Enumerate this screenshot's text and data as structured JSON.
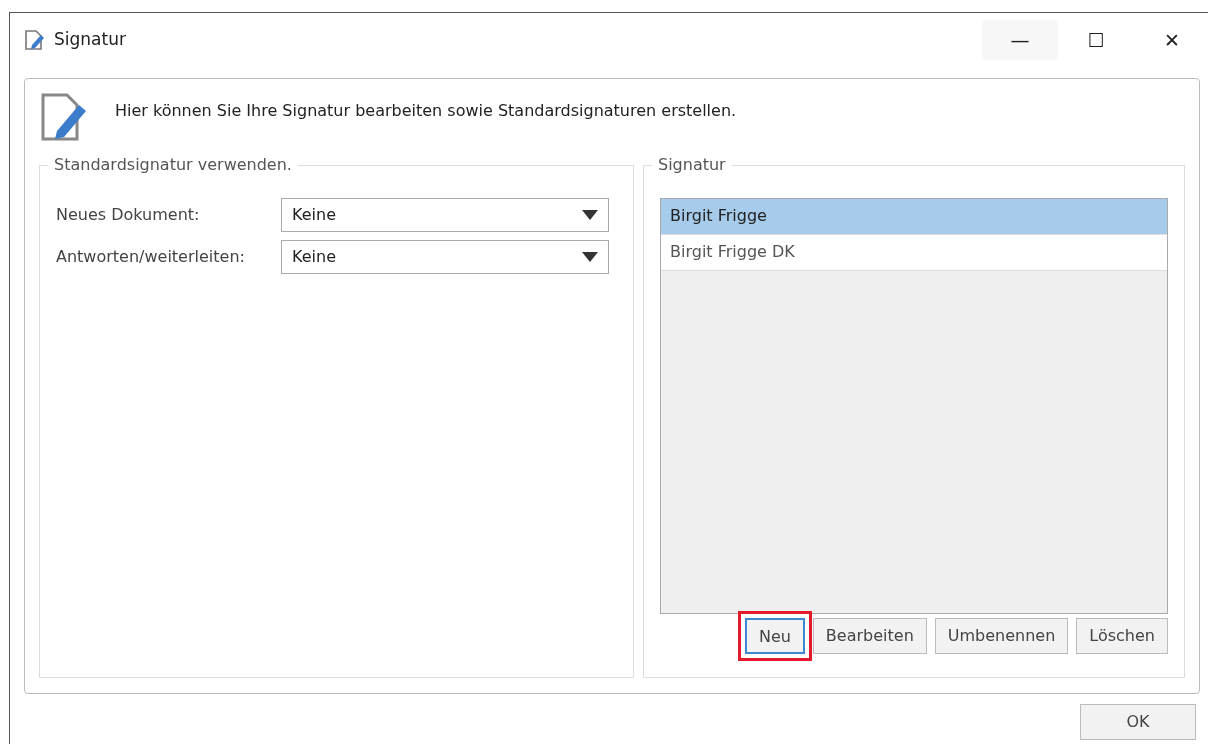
{
  "window": {
    "title": "Signatur",
    "controls": [
      "—",
      "☐",
      "✕"
    ]
  },
  "intro": "Hier können Sie Ihre Signatur bearbeiten sowie Standardsignaturen erstellen.",
  "default_group": {
    "legend": "Standardsignatur verwenden.",
    "fields": [
      {
        "label": "Neues Dokument:",
        "value": "Keine"
      },
      {
        "label": "Antworten/weiterleiten:",
        "value": "Keine"
      }
    ]
  },
  "signature_group": {
    "legend": "Signatur",
    "items": [
      {
        "label": "Birgit Frigge",
        "selected": true
      },
      {
        "label": "Birgit Frigge DK",
        "selected": false
      }
    ],
    "buttons": [
      {
        "label": "Neu",
        "highlighted": true
      },
      {
        "label": "Bearbeiten",
        "highlighted": false
      },
      {
        "label": "Umbenennen",
        "highlighted": false
      },
      {
        "label": "Löschen",
        "highlighted": false
      }
    ]
  },
  "footer_buttons": [
    "OK"
  ]
}
